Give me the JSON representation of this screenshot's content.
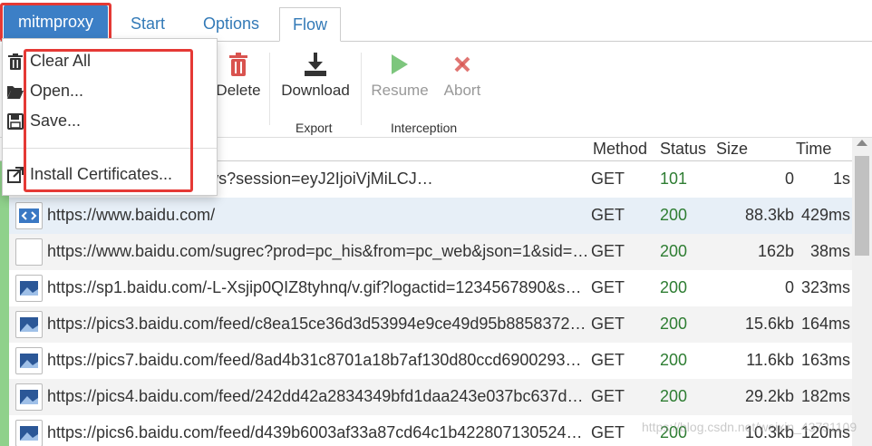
{
  "tabs": {
    "brand": "mitmproxy",
    "start": "Start",
    "options": "Options",
    "flow": "Flow"
  },
  "toolbar": {
    "delete": "Delete",
    "download": "Download",
    "resume": "Resume",
    "abort": "Abort",
    "group_export": "Export",
    "group_interception": "Interception"
  },
  "menu": {
    "clear_all": "Clear All",
    "open": "Open...",
    "save": "Save...",
    "install_certs": "Install Certificates..."
  },
  "table": {
    "headers": {
      "method": "Method",
      "status": "Status",
      "size": "Size",
      "time": "Time"
    },
    "rows": [
      {
        "path": "_sockets/u/70103670/ws?session=eyJ2IjoiVjMiLCJ…",
        "method": "GET",
        "status": "101",
        "size": "0",
        "time": "1s"
      },
      {
        "path": "https://www.baidu.com/",
        "method": "GET",
        "status": "200",
        "size": "88.3kb",
        "time": "429ms"
      },
      {
        "path": "https://www.baidu.com/sugrec?prod=pc_his&from=pc_web&json=1&sid=3…",
        "method": "GET",
        "status": "200",
        "size": "162b",
        "time": "38ms"
      },
      {
        "path": "https://sp1.baidu.com/-L-Xsjip0QIZ8tyhnq/v.gif?logactid=1234567890&sho…",
        "method": "GET",
        "status": "200",
        "size": "0",
        "time": "323ms"
      },
      {
        "path": "https://pics3.baidu.com/feed/c8ea15ce36d3d53994e9ce49d95b8858372ab…",
        "method": "GET",
        "status": "200",
        "size": "15.6kb",
        "time": "164ms"
      },
      {
        "path": "https://pics7.baidu.com/feed/8ad4b31c8701a18b7af130d80ccd69002938fe…",
        "method": "GET",
        "status": "200",
        "size": "11.6kb",
        "time": "163ms"
      },
      {
        "path": "https://pics4.baidu.com/feed/242dd42a2834349bfd1daa243e037bc637d3b…",
        "method": "GET",
        "status": "200",
        "size": "29.2kb",
        "time": "182ms"
      },
      {
        "path": "https://pics6.baidu.com/feed/d439b6003af33a87cd64c1b4228071305243b…",
        "method": "GET",
        "status": "200",
        "size": "10.3kb",
        "time": "120ms"
      }
    ]
  },
  "watermark": "https://blog.csdn.net/weixin_43731109"
}
